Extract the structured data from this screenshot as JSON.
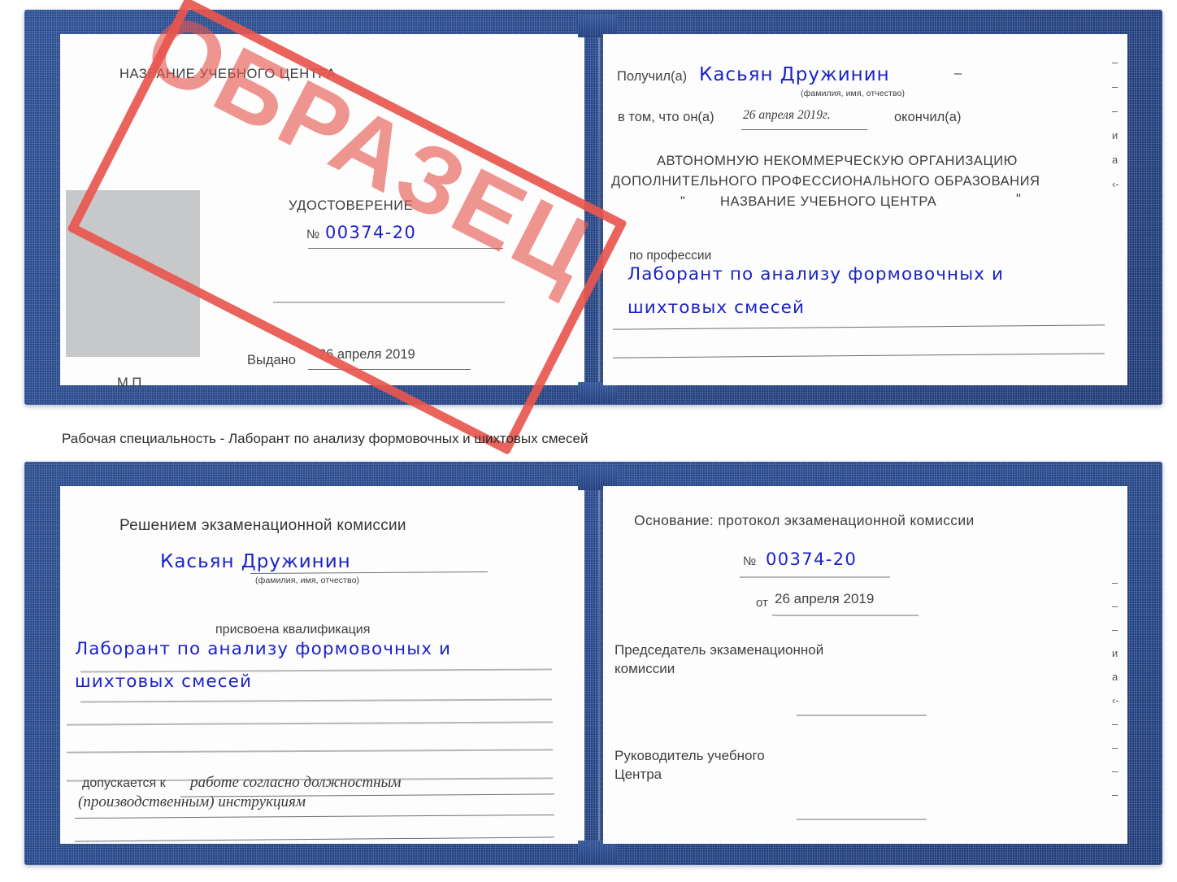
{
  "document": {
    "type": "certificate-sample",
    "stamp_label": "ОБРАЗЕЦ",
    "accent_red": "#e8564e",
    "cover_blue": "#27478a",
    "ink_blue": "#1b23c8"
  },
  "certificate_top": {
    "left_page": {
      "center_name": "НАЗВАНИЕ УЧЕБНОГО ЦЕНТРА",
      "doc_title": "УДОСТОВЕРЕНИЕ",
      "number_symbol": "№",
      "number_value": "00374-20",
      "issued_label": "Выдано",
      "issued_date": "26 апреля 2019",
      "seal_label": "М.П."
    },
    "right_page": {
      "received_label": "Получил(а)",
      "received_name": "Касьян Дружинин",
      "name_hint": "(фамилия, имя, отчество)",
      "dash": "–",
      "in_that_label": "в том, что он(а)",
      "completion_date": "26 апреля 2019г.",
      "finished_label": "окончил(а)",
      "org_line1": "АВТОНОМНУЮ НЕКОММЕРЧЕСКУЮ ОРГАНИЗАЦИЮ",
      "org_line2": "ДОПОЛНИТЕЛЬНОГО ПРОФЕССИОНАЛЬНОГО ОБРАЗОВАНИЯ",
      "org_quote_open": "\"",
      "org_line3": "НАЗВАНИЕ УЧЕБНОГО ЦЕНТРА",
      "org_quote_close": "\"",
      "profession_label": "по профессии",
      "profession_line1": "Лаборант по анализу формовочных и",
      "profession_line2": "шихтовых смесей",
      "edge_fragments": [
        "–",
        "–",
        "–",
        "и",
        "а",
        "‹-"
      ]
    }
  },
  "caption": {
    "text": "Рабочая специальность - Лаборант по анализу формовочных и шихтовых смесей"
  },
  "certificate_bottom": {
    "left_page": {
      "decision_title": "Решением экзаменационной комиссии",
      "person_name": "Касьян Дружинин",
      "name_hint": "(фамилия, имя, отчество)",
      "qualification_label": "присвоена квалификация",
      "qualification_line1": "Лаборант по анализу формовочных и",
      "qualification_line2": "шихтовых смесей",
      "admitted_label": "допускается к",
      "admitted_line1": "работе согласно должностным",
      "admitted_line2": "(производственным) инструкциям"
    },
    "right_page": {
      "basis_label": "Основание: протокол экзаменационной комиссии",
      "number_symbol": "№",
      "number_value": "00374-20",
      "from_label": "от",
      "from_date": "26 апреля 2019",
      "chairman_line1": "Председатель экзаменационной",
      "chairman_line2": "комиссии",
      "head_line1": "Руководитель учебного",
      "head_line2": "Центра",
      "edge_fragments": [
        "–",
        "–",
        "–",
        "и",
        "а",
        "‹-",
        "–",
        "–",
        "–",
        "–"
      ]
    }
  }
}
